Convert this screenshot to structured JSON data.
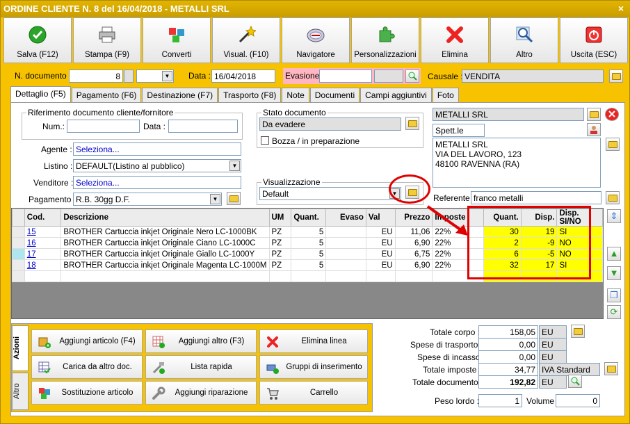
{
  "window": {
    "title": "ORDINE CLIENTE N. 8 del 16/04/2018 - METALLI SRL",
    "close": "×"
  },
  "toolbar": [
    {
      "label": "Salva (F12)",
      "icon": "check-icon"
    },
    {
      "label": "Stampa (F9)",
      "icon": "printer-icon"
    },
    {
      "label": "Converti",
      "icon": "convert-icon"
    },
    {
      "label": "Visual. (F10)",
      "icon": "magic-wand-icon"
    },
    {
      "label": "Navigatore",
      "icon": "compass-icon"
    },
    {
      "label": "Personalizzazioni",
      "icon": "puzzle-icon"
    },
    {
      "label": "Elimina",
      "icon": "delete-x-icon"
    },
    {
      "label": "Altro",
      "icon": "magnifier-icon"
    },
    {
      "label": "Uscita (ESC)",
      "icon": "power-icon"
    }
  ],
  "header": {
    "ndoc_label": "N. documento :",
    "ndoc_value": "8",
    "data_label": "Data :",
    "data_value": "16/04/2018",
    "evasione_label": "Evasione:",
    "causale_label": "Causale :",
    "causale_value": "VENDITA"
  },
  "tabs": [
    "Dettaglio (F5)",
    "Pagamento (F6)",
    "Destinazione (F7)",
    "Trasporto (F8)",
    "Note",
    "Documenti",
    "Campi aggiuntivi",
    "Foto"
  ],
  "riferimento": {
    "legend": "Riferimento documento cliente/fornitore",
    "num_label": "Num.:",
    "data_label": "Data :"
  },
  "fields": {
    "agente_label": "Agente :",
    "agente_value": "Seleziona...",
    "listino_label": "Listino :",
    "listino_value": "DEFAULT(Listino al pubblico)",
    "venditore_label": "Venditore :",
    "venditore_value": "Seleziona...",
    "pagamento_label": "Pagamento :",
    "pagamento_value": "R.B. 30gg D.F."
  },
  "stato": {
    "legend": "Stato documento",
    "value": "Da evadere",
    "bozza_label": "Bozza / in preparazione"
  },
  "visualizzazione": {
    "legend": "Visualizzazione",
    "value": "Default"
  },
  "cliente": {
    "name": "METALLI SRL",
    "title": "Spett.le",
    "address_lines": [
      "METALLI SRL",
      "VIA DEL LAVORO, 123",
      "48100 RAVENNA (RA)"
    ],
    "referente_label": "Referente",
    "referente_value": "franco metalli"
  },
  "grid": {
    "columns": [
      "Cod.",
      "Descrizione",
      "UM",
      "Quant.",
      "Evaso",
      "Val",
      "Prezzo",
      "Imposte",
      "Quant.",
      "Disp.",
      "Disp. SI/NO"
    ],
    "rows": [
      {
        "cod": "15",
        "descr": "BROTHER Cartuccia inkjet Originale Nero LC-1000BK",
        "um": "PZ",
        "qta": "5",
        "evaso": "",
        "val": "EU",
        "prezzo": "11,06",
        "imposte": "22%",
        "quant": "30",
        "disp": "19",
        "sino": "SI"
      },
      {
        "cod": "16",
        "descr": "BROTHER Cartuccia inkjet Originale Ciano LC-1000C",
        "um": "PZ",
        "qta": "5",
        "evaso": "",
        "val": "EU",
        "prezzo": "6,90",
        "imposte": "22%",
        "quant": "2",
        "disp": "-9",
        "sino": "NO"
      },
      {
        "cod": "17",
        "descr": "BROTHER Cartuccia inkjet Originale Giallo LC-1000Y",
        "um": "PZ",
        "qta": "5",
        "evaso": "",
        "val": "EU",
        "prezzo": "6,75",
        "imposte": "22%",
        "quant": "6",
        "disp": "-5",
        "sino": "NO"
      },
      {
        "cod": "18",
        "descr": "BROTHER Cartuccia inkjet Originale Magenta LC-1000M",
        "um": "PZ",
        "qta": "5",
        "evaso": "",
        "val": "EU",
        "prezzo": "6,90",
        "imposte": "22%",
        "quant": "32",
        "disp": "17",
        "sino": "SI"
      }
    ]
  },
  "actions": {
    "tab_azioni": "Azioni",
    "tab_altro": "Altro",
    "buttons": [
      {
        "label": "Aggiungi articolo (F4)",
        "icon": "add-article-icon"
      },
      {
        "label": "Aggiungi altro (F3)",
        "icon": "add-other-icon"
      },
      {
        "label": "Elimina linea",
        "icon": "delete-line-icon"
      },
      {
        "label": "Carica da altro doc.",
        "icon": "load-doc-icon"
      },
      {
        "label": "Lista rapida",
        "icon": "quick-list-icon"
      },
      {
        "label": "Gruppi di inserimento",
        "icon": "groups-icon"
      },
      {
        "label": "Sostituzione articolo",
        "icon": "replace-icon"
      },
      {
        "label": "Aggiungi riparazione",
        "icon": "wrench-icon"
      },
      {
        "label": "Carrello",
        "icon": "cart-icon"
      }
    ]
  },
  "totals": {
    "corpo_label": "Totale corpo :",
    "corpo_value": "158,05",
    "corpo_cur": "EU",
    "trasporto_label": "Spese di trasporto :",
    "trasporto_value": "0,00",
    "trasporto_cur": "EU",
    "incasso_label": "Spese di incasso :",
    "incasso_value": "0,00",
    "incasso_cur": "EU",
    "imposte_label": "Totale imposte :",
    "imposte_value": "34,77",
    "imposte_desc": "IVA Standard",
    "documento_label": "Totale documento :",
    "documento_value": "192,82",
    "documento_cur": "EU",
    "peso_label": "Peso lordo :",
    "peso_value": "1",
    "volume_label": "Volume :",
    "volume_value": "0"
  }
}
